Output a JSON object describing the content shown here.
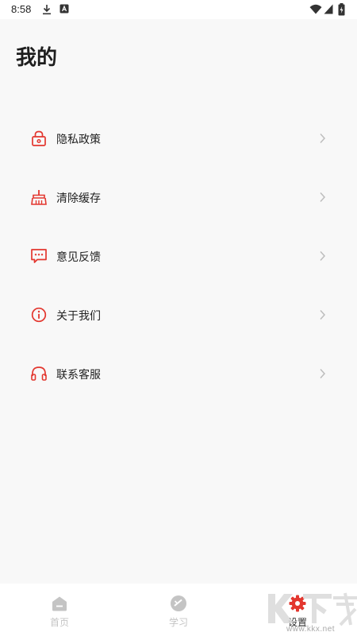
{
  "status_bar": {
    "time": "8:58",
    "icons": [
      "download-icon",
      "notification-a-icon",
      "wifi-icon",
      "signal-icon",
      "battery-charging-icon"
    ]
  },
  "header": {
    "title": "我的"
  },
  "menu": {
    "items": [
      {
        "label": "隐私政策",
        "icon": "lock-icon"
      },
      {
        "label": "清除缓存",
        "icon": "broom-icon"
      },
      {
        "label": "意见反馈",
        "icon": "message-icon"
      },
      {
        "label": "关于我们",
        "icon": "info-icon"
      },
      {
        "label": "联系客服",
        "icon": "headset-icon"
      }
    ]
  },
  "tabbar": {
    "tabs": [
      {
        "label": "首页",
        "icon": "home-icon",
        "active": false
      },
      {
        "label": "学习",
        "icon": "study-icon",
        "active": false
      },
      {
        "label": "设置",
        "icon": "settings-icon",
        "active": true
      }
    ]
  },
  "watermark": {
    "text": "K下载",
    "url": "www.kkx.net"
  },
  "colors": {
    "accent": "#e3372f",
    "page_background": "#f8f8f8",
    "tab_inactive": "#c4c4c4",
    "chevron": "#bdbdbd"
  }
}
